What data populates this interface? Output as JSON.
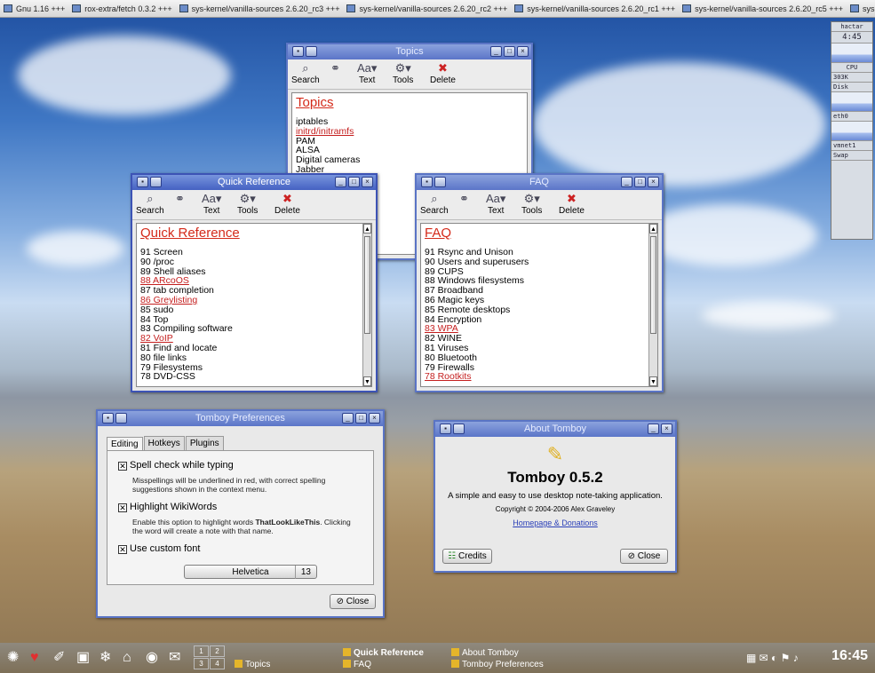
{
  "top_panel": {
    "items": [
      "Gnu 1.16 +++",
      "rox-extra/fetch 0.3.2 +++",
      "sys-kernel/vanilla-sources 2.6.20_rc3 +++",
      "sys-kernel/vanilla-sources 2.6.20_rc2 +++",
      "sys-kernel/vanilla-sources 2.6.20_rc1 +++",
      "sys-kernel/vanilla-sources 2.6.20_rc5 +++",
      "sys-kernel/vanilla-sourc"
    ]
  },
  "toolbar": {
    "search": "Search",
    "text": "Text",
    "tools": "Tools",
    "delete": "Delete"
  },
  "topics": {
    "window_title": "Topics",
    "note_title": "Topics",
    "lines": [
      {
        "t": "iptables",
        "link": false
      },
      {
        "t": "initrd/initramfs",
        "link": true
      },
      {
        "t": "PAM",
        "link": false
      },
      {
        "t": "ALSA",
        "link": false
      },
      {
        "t": "Digital cameras",
        "link": false
      },
      {
        "t": "Jabber",
        "link": false
      }
    ]
  },
  "quick_reference": {
    "window_title": "Quick Reference",
    "note_title": "Quick Reference",
    "lines": [
      {
        "t": "91 Screen",
        "link": false
      },
      {
        "t": "90 /proc",
        "link": false
      },
      {
        "t": "89 Shell aliases",
        "link": false
      },
      {
        "t": "88 ARcoOS",
        "link": true
      },
      {
        "t": "87 tab completion",
        "link": false
      },
      {
        "t": "86 Greylisting",
        "link": true
      },
      {
        "t": "85 sudo",
        "link": false
      },
      {
        "t": "84 Top",
        "link": false
      },
      {
        "t": "83 Compiling software",
        "link": false
      },
      {
        "t": "82 VoIP",
        "link": true
      },
      {
        "t": "81 Find and locate",
        "link": false
      },
      {
        "t": "80 file links",
        "link": false
      },
      {
        "t": "79 Filesystems",
        "link": false
      },
      {
        "t": "78 DVD-CSS",
        "link": false
      }
    ]
  },
  "faq": {
    "window_title": "FAQ",
    "note_title": "FAQ",
    "lines": [
      {
        "t": "91 Rsync and Unison",
        "link": false
      },
      {
        "t": "90 Users and superusers",
        "link": false
      },
      {
        "t": "89 CUPS",
        "link": false
      },
      {
        "t": "88 Windows filesystems",
        "link": false
      },
      {
        "t": "87 Broadband",
        "link": false
      },
      {
        "t": "86 Magic keys",
        "link": false
      },
      {
        "t": "85 Remote desktops",
        "link": false
      },
      {
        "t": "84 Encryption",
        "link": false
      },
      {
        "t": "83 WPA",
        "link": true
      },
      {
        "t": "82 WINE",
        "link": false
      },
      {
        "t": "81 Viruses",
        "link": false
      },
      {
        "t": "80 Bluetooth",
        "link": false
      },
      {
        "t": "79 Firewalls",
        "link": false
      },
      {
        "t": "78 Rootkits",
        "link": true
      }
    ]
  },
  "preferences": {
    "window_title": "Tomboy Preferences",
    "tabs": [
      "Editing",
      "Hotkeys",
      "Plugins"
    ],
    "spell_label": "Spell check while typing",
    "spell_desc": "Misspellings will be underlined in red, with correct spelling suggestions shown in the context menu.",
    "wiki_label": "Highlight WikiWords",
    "wiki_desc_pre": "Enable this option to highlight words ",
    "wiki_desc_bold": "ThatLookLikeThis",
    "wiki_desc_post": ". Clicking the word will create a note with that name.",
    "font_label": "Use custom font",
    "font_name": "Helvetica",
    "font_size": "13",
    "close": "Close"
  },
  "about": {
    "window_title": "About Tomboy",
    "app_name": "Tomboy 0.5.2",
    "tagline": "A simple and easy to use desktop note-taking application.",
    "copyright": "Copyright © 2004-2006 Alex Graveley",
    "homepage": "Homepage & Donations",
    "credits": "Credits",
    "close": "Close"
  },
  "taskbar": {
    "pager": [
      "1",
      "2",
      "3",
      "4"
    ],
    "tasks": [
      "Topics",
      "Quick Reference",
      "FAQ",
      "About Tomboy",
      "Tomboy Preferences"
    ],
    "clock": "16:45"
  },
  "sysmon": {
    "host": "hactar",
    "time": "4:45",
    "cpu": "CPU",
    "disk": "Disk",
    "eth": "eth0",
    "vmnet": "vmnet1",
    "swap": "Swap",
    "mem": "303K"
  }
}
